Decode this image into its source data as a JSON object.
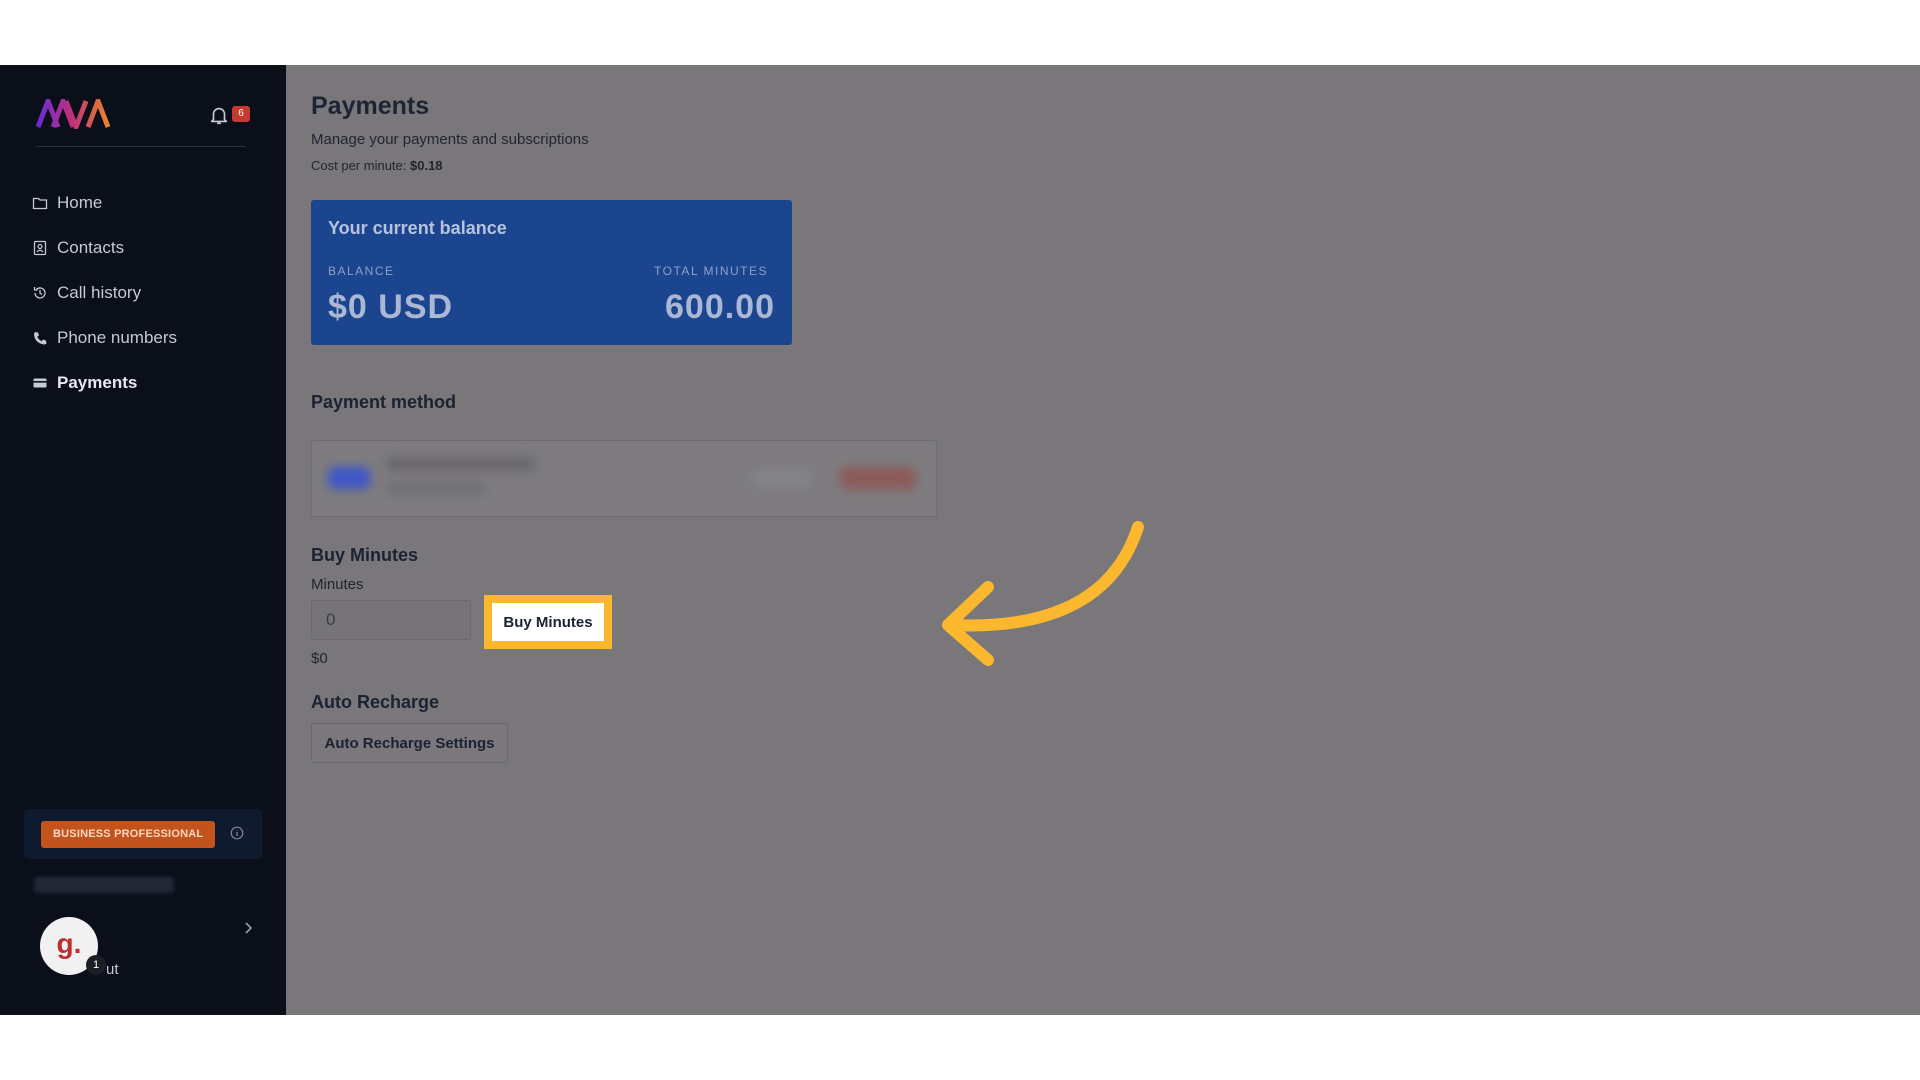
{
  "sidebar": {
    "brand": "AVA",
    "notification_count": "6",
    "nav": [
      {
        "label": "Home",
        "icon": "folder-icon"
      },
      {
        "label": "Contacts",
        "icon": "contacts-icon"
      },
      {
        "label": "Call history",
        "icon": "history-icon"
      },
      {
        "label": "Phone numbers",
        "icon": "phone-icon"
      },
      {
        "label": "Payments",
        "icon": "card-icon",
        "active": true
      }
    ],
    "plan_badge": "BUSINESS PROFESSIONAL",
    "logout_fragment": "ut",
    "avatar_letter": "g.",
    "avatar_count": "1"
  },
  "main": {
    "title": "Payments",
    "subtitle": "Manage your payments and subscriptions",
    "cost_label": "Cost per minute:",
    "cost_value": "$0.18",
    "balance_card": {
      "title": "Your current balance",
      "balance_label": "BALANCE",
      "balance_value": "$0 USD",
      "minutes_label": "TOTAL MINUTES",
      "minutes_value": "600.00"
    },
    "payment_method_title": "Payment method",
    "buy_minutes": {
      "title": "Buy Minutes",
      "minutes_label": "Minutes",
      "input_value": "0",
      "button_label": "Buy Minutes",
      "price": "$0"
    },
    "auto_recharge": {
      "title": "Auto Recharge",
      "button_label": "Auto Recharge Settings"
    }
  },
  "colors": {
    "sidebar_bg": "#0a0f1a",
    "overlay_bg": "#797779",
    "balance_card_bg": "#1c458f",
    "highlight": "#fbb82f",
    "plan_badge": "#c2531c"
  }
}
